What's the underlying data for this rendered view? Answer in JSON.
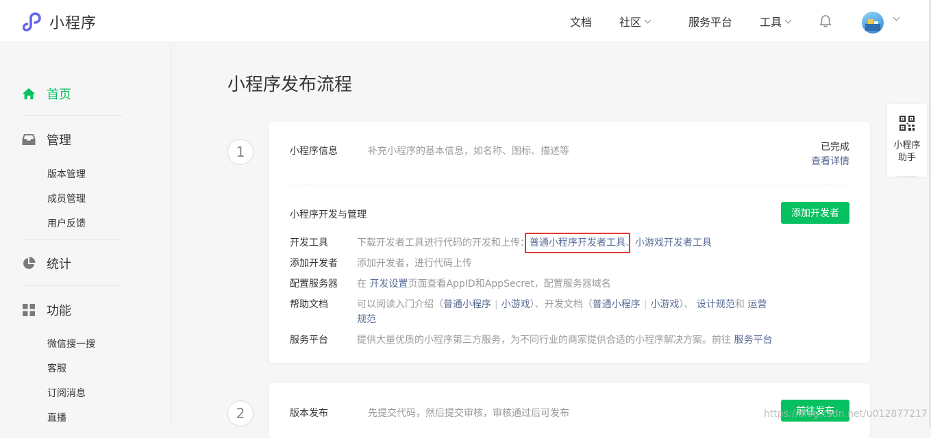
{
  "header": {
    "logo_text": "小程序",
    "nav": {
      "docs": "文档",
      "community": "社区",
      "service_platform": "服务平台",
      "tools": "工具"
    }
  },
  "sidebar": {
    "home": "首页",
    "manage": "管理",
    "manage_items": [
      "版本管理",
      "成员管理",
      "用户反馈"
    ],
    "stats": "统计",
    "features": "功能",
    "features_items": [
      "微信搜一搜",
      "客服",
      "订阅消息",
      "直播"
    ]
  },
  "main": {
    "title": "小程序发布流程",
    "step1": {
      "number": "1",
      "title": "小程序信息",
      "desc": "补充小程序的基本信息，如名称、图标、描述等",
      "status": "已完成",
      "detail_link": "查看详情",
      "dev_section_title": "小程序开发与管理",
      "add_dev_button": "添加开发者",
      "rows": {
        "tools": {
          "label": "开发工具",
          "text": "下载开发者工具进行代码的开发和上传：",
          "link1": "普通小程序开发者工具",
          "sep": "、",
          "link2": "小游戏开发者工具"
        },
        "add_dev": {
          "label": "添加开发者",
          "text": "添加开发者，进行代码上传"
        },
        "server": {
          "label": "配置服务器",
          "pre": "在",
          "link": "开发设置",
          "post": "页面查看AppID和AppSecret，配置服务器域名"
        },
        "help": {
          "label": "帮助文档",
          "t1": "可以阅读入门介绍（",
          "l1": "普通小程序",
          "bar": "|",
          "l2": "小游戏",
          "t2": "）、开发文档（",
          "l3": "普通小程序",
          "l4": "小游戏",
          "t3": "）、",
          "l5": "设计规范",
          "t4": "和",
          "l6a": "运营",
          "l6b": "规范"
        },
        "service": {
          "label": "服务平台",
          "text": "提供大量优质的小程序第三方服务，为不同行业的商家提供合适的小程序解决方案。前往",
          "link": "服务平台"
        }
      }
    },
    "step2": {
      "number": "2",
      "title": "版本发布",
      "desc": "先提交代码，然后提交审核，审核通过后可发布",
      "button": "前往发布"
    }
  },
  "assistant": {
    "line1": "小程序",
    "line2": "助手"
  },
  "watermark": "https://blog.csdn.net/u012877217",
  "colors": {
    "brand_green": "#07c160",
    "link_blue": "#576b95",
    "highlight_red": "#e53935"
  }
}
